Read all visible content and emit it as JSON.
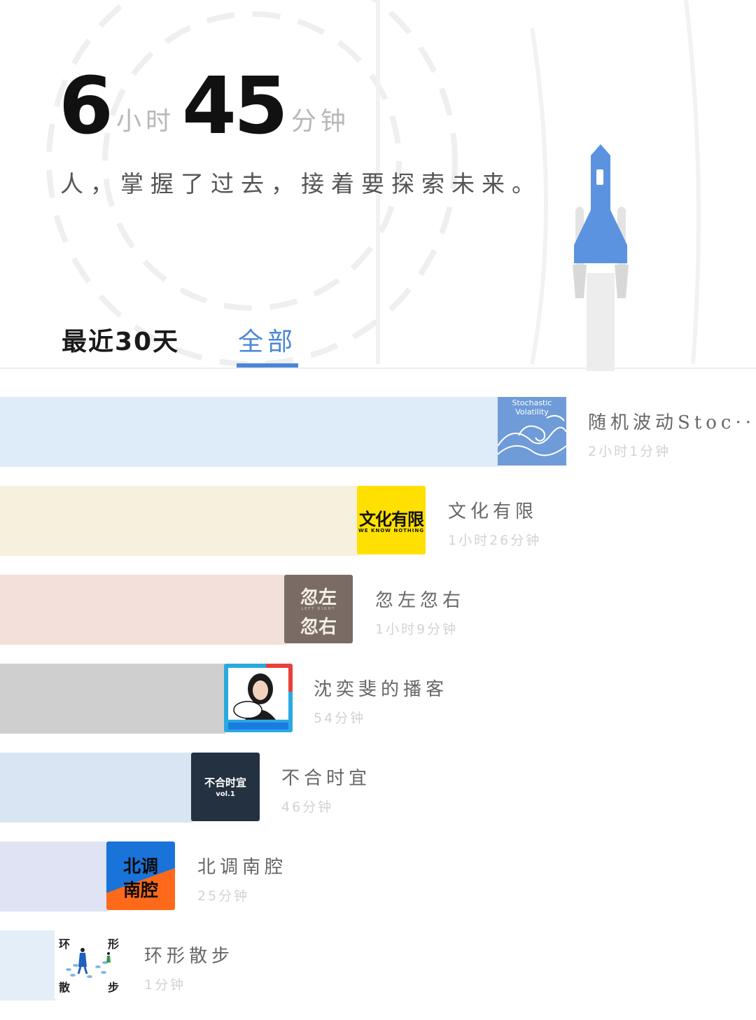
{
  "summary": {
    "hours_value": "6",
    "hours_unit": "小时",
    "minutes_value": "45",
    "minutes_unit": "分钟",
    "quote": "人，掌握了过去，接着要探索未来。"
  },
  "tabs": [
    {
      "label": "最近30天",
      "active": false
    },
    {
      "label": "全部",
      "active": true
    }
  ],
  "colors": {
    "accent": "#4a86d8",
    "rocket": "#5b93e0"
  },
  "podcasts": [
    {
      "title": "随机波动Stoc···",
      "duration": "2小时1分钟",
      "bar_color": "#deebf8",
      "cover": {
        "icon": "wave-cover",
        "text": "Stochastic Volatility",
        "bg": "#6f9bd8"
      }
    },
    {
      "title": "文化有限",
      "duration": "1小时26分钟",
      "bar_color": "#f6f1dc",
      "cover": {
        "icon": "text-cover",
        "text": "文化有限",
        "sub": "WE KNOW NOTHING",
        "bg": "#ffe000"
      }
    },
    {
      "title": "忽左忽右",
      "duration": "1小时9分钟",
      "bar_color": "#f3e0db",
      "cover": {
        "icon": "text-cover",
        "text": "忽左",
        "text2": "忽右",
        "sub": "LEFT RIGHT",
        "bg": "#7a6c64"
      }
    },
    {
      "title": "沈奕斐的播客",
      "duration": "54分钟",
      "bar_color": "#cfcfcf",
      "cover": {
        "icon": "portrait-cover",
        "bg": "#3bb88a"
      }
    },
    {
      "title": "不合时宜",
      "duration": "46分钟",
      "bar_color": "#d9e5f2",
      "cover": {
        "icon": "text-cover",
        "text": "不合时宜",
        "sub": "vol.1",
        "bg": "#243140"
      }
    },
    {
      "title": "北调南腔",
      "duration": "25分钟",
      "bar_color": "#dfe3f3",
      "cover": {
        "icon": "text-cover",
        "text": "北调",
        "text2": "南腔",
        "bg": "#1a73d8",
        "bg2": "#ff6a1a"
      }
    },
    {
      "title": "环形散步",
      "duration": "1分钟",
      "bar_color": "#e3eef8",
      "cover": {
        "icon": "walk-cover",
        "c1": "环",
        "c2": "形",
        "c3": "散",
        "c4": "步",
        "bg": "#ffffff"
      }
    }
  ]
}
